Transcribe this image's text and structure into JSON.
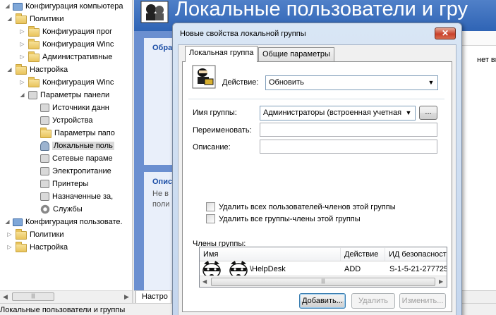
{
  "tree": {
    "items": [
      {
        "label": "Конфигурация компьютера",
        "level": 0,
        "icon": "computer-icon",
        "expander": "collapse"
      },
      {
        "label": "Политики",
        "level": 1,
        "icon": "folder-icon",
        "expander": "collapse"
      },
      {
        "label": "Конфигурация прог",
        "level": 2,
        "icon": "folder-icon",
        "expander": "expand"
      },
      {
        "label": "Конфигурация Winc",
        "level": 2,
        "icon": "folder-icon",
        "expander": "expand"
      },
      {
        "label": "Административные",
        "level": 2,
        "icon": "folder-icon",
        "expander": "expand"
      },
      {
        "label": "Настройка",
        "level": 1,
        "icon": "folder-icon",
        "expander": "collapse"
      },
      {
        "label": "Конфигурация Winc",
        "level": 2,
        "icon": "folder-icon",
        "expander": "expand"
      },
      {
        "label": "Параметры панели",
        "level": 2,
        "icon": "control-panel-icon",
        "expander": "collapse"
      },
      {
        "label": "Источники данн",
        "level": 3,
        "icon": "data-sources-icon",
        "expander": ""
      },
      {
        "label": "Устройства",
        "level": 3,
        "icon": "devices-icon",
        "expander": ""
      },
      {
        "label": "Параметры папо",
        "level": 3,
        "icon": "folder-options-icon",
        "expander": ""
      },
      {
        "label": "Локальные поль",
        "level": 3,
        "icon": "local-users-icon",
        "expander": "",
        "selected": true
      },
      {
        "label": "Сетевые параме",
        "level": 3,
        "icon": "network-icon",
        "expander": ""
      },
      {
        "label": "Электропитание",
        "level": 3,
        "icon": "power-icon",
        "expander": ""
      },
      {
        "label": "Принтеры",
        "level": 3,
        "icon": "printer-icon",
        "expander": ""
      },
      {
        "label": "Назначенные за,",
        "level": 3,
        "icon": "scheduled-tasks-icon",
        "expander": ""
      },
      {
        "label": "Службы",
        "level": 3,
        "icon": "services-icon",
        "expander": ""
      },
      {
        "label": "Конфигурация пользовате.",
        "level": 0,
        "icon": "user-config-icon",
        "expander": "collapse"
      },
      {
        "label": "Политики",
        "level": 1,
        "icon": "folder-icon",
        "expander": "expand"
      },
      {
        "label": "Настройка",
        "level": 1,
        "icon": "folder-icon",
        "expander": "expand"
      }
    ]
  },
  "background": {
    "title": "Локальные пользователи и гру",
    "card1_heading": "Обра",
    "card2_heading": "Опис",
    "card2_text_line1": "Не в",
    "card2_text_line2": "поли",
    "list_cell": "нет виде.",
    "bottom_tab": "Настро",
    "status_text": "Локальные пользователи и группы"
  },
  "dialog": {
    "title": "Новые свойства локальной группы",
    "tabs": [
      "Локальная группа",
      "Общие параметры"
    ],
    "action_label": "Действие:",
    "action_value": "Обновить",
    "group_name_label": "Имя группы:",
    "group_name_value": "Администраторы (встроенная учетная",
    "browse_label": "...",
    "rename_label": "Переименовать:",
    "description_label": "Описание:",
    "checkbox_delete_users": "Удалить всех пользователей-членов этой группы",
    "checkbox_delete_groups": "Удалить все группы-члены этой группы",
    "members_label": "Члены группы:",
    "members_columns": [
      "Имя",
      "Действие",
      "ИД безопасност"
    ],
    "members_rows": [
      {
        "name": "\\HelpDesk",
        "action": "ADD",
        "sid": "S-1-5-21-277725"
      }
    ],
    "buttons": {
      "add": "Добавить...",
      "remove": "Удалить",
      "change": "Изменить..."
    }
  }
}
